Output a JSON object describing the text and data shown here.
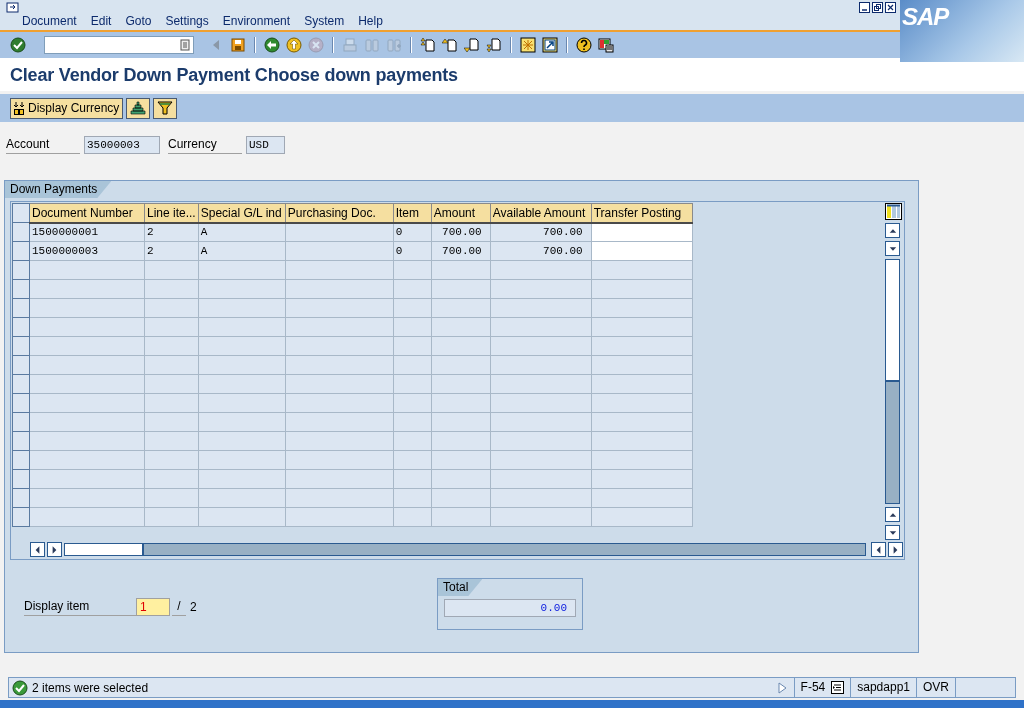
{
  "window": {
    "title": "Clear Vendor Down Payment Choose down payments",
    "logo": "SAP"
  },
  "menu": [
    "Document",
    "Edit",
    "Goto",
    "Settings",
    "Environment",
    "System",
    "Help"
  ],
  "toolbar": {
    "groups": [
      [
        {
          "kind": "enter",
          "disabled": false
        },
        {
          "kind": "command-field"
        },
        {
          "kind": "history",
          "disabled": false
        },
        {
          "kind": "save",
          "disabled": false
        }
      ],
      [
        {
          "kind": "back",
          "disabled": false
        },
        {
          "kind": "exit",
          "disabled": false
        },
        {
          "kind": "cancel",
          "disabled": true
        }
      ],
      [
        {
          "kind": "print",
          "disabled": true
        },
        {
          "kind": "find",
          "disabled": true
        },
        {
          "kind": "find-next",
          "disabled": true
        }
      ],
      [
        {
          "kind": "first-page",
          "disabled": false
        },
        {
          "kind": "previous-page",
          "disabled": false
        },
        {
          "kind": "next-page",
          "disabled": false
        },
        {
          "kind": "last-page",
          "disabled": false
        }
      ],
      [
        {
          "kind": "new-session",
          "disabled": false
        },
        {
          "kind": "shortcut",
          "disabled": false
        }
      ],
      [
        {
          "kind": "help",
          "disabled": false
        },
        {
          "kind": "layout",
          "disabled": false
        }
      ]
    ]
  },
  "app_toolbar": [
    {
      "kind": "expand",
      "label": "Display Currency"
    },
    {
      "kind": "print"
    },
    {
      "kind": "filter"
    }
  ],
  "header_fields": [
    {
      "label": "Account",
      "value": "35000003"
    },
    {
      "label": "Currency",
      "value": "USD"
    }
  ],
  "down_payments": {
    "title": "Down Payments",
    "table": {
      "columns": [
        {
          "label": "Document Number",
          "kind": "text"
        },
        {
          "label": "Line ite...",
          "kind": "text"
        },
        {
          "label": "Special G/L ind",
          "kind": "text"
        },
        {
          "label": "Purchasing Doc.",
          "kind": "text"
        },
        {
          "label": "Item",
          "kind": "text"
        },
        {
          "label": "Amount",
          "kind": "amount"
        },
        {
          "label": "Available Amount",
          "kind": "amount"
        },
        {
          "label": "Transfer Posting",
          "kind": "input"
        }
      ],
      "rows": [
        {
          "selected": false,
          "cells": [
            "1500000001",
            "2",
            "A",
            null,
            "0",
            "700.00",
            "700.00",
            null
          ]
        },
        {
          "selected": false,
          "cells": [
            "1500000003",
            "2",
            "A",
            null,
            "0",
            "700.00",
            "700.00",
            null
          ]
        }
      ]
    },
    "display_item": {
      "label": "Display item",
      "value": "1",
      "separator": "/",
      "count": "2"
    },
    "total": {
      "title": "Total",
      "value": "0.00"
    }
  },
  "status_bar": {
    "message": "2 items were selected",
    "transaction": "F-54",
    "server": "sapdapp1",
    "mode": "OVR"
  }
}
